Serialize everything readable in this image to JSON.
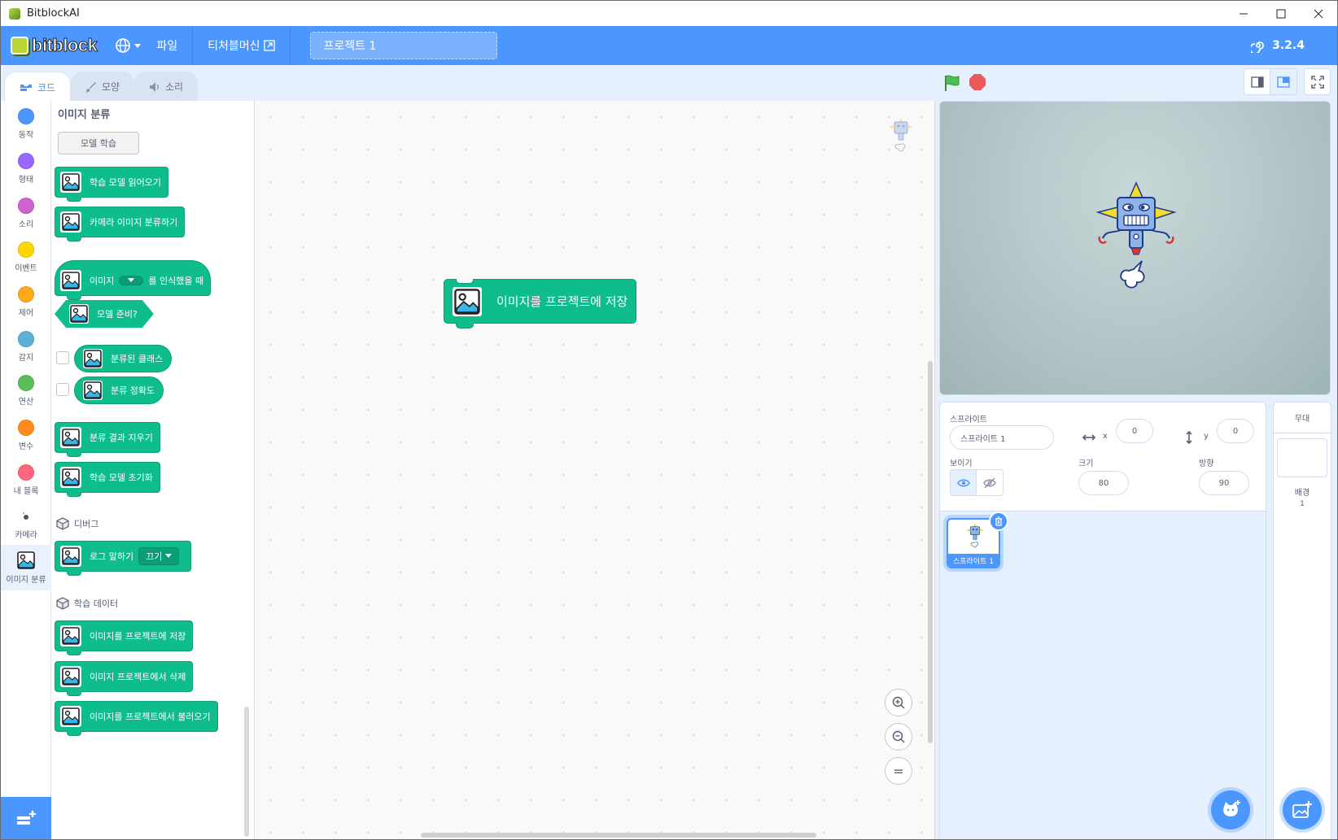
{
  "window": {
    "title": "BitblockAI",
    "controls": [
      "—",
      "☐",
      "✕"
    ]
  },
  "menubar": {
    "logo_text": "bitblock",
    "file_label": "파일",
    "teacher_label": "티처블머신",
    "project_title": "프로젝트 1",
    "version": "3.2.4"
  },
  "tabs": [
    {
      "label": "코드",
      "active": true
    },
    {
      "label": "모양",
      "active": false
    },
    {
      "label": "소리",
      "active": false
    }
  ],
  "categories": [
    {
      "label": "동작",
      "color": "#4c97ff"
    },
    {
      "label": "형태",
      "color": "#9966ff"
    },
    {
      "label": "소리",
      "color": "#cf63cf"
    },
    {
      "label": "이벤트",
      "color": "#ffd500"
    },
    {
      "label": "제어",
      "color": "#ffab19"
    },
    {
      "label": "감지",
      "color": "#5cb1d6"
    },
    {
      "label": "연산",
      "color": "#59c059"
    },
    {
      "label": "변수",
      "color": "#ff8c1a"
    },
    {
      "label": "내 블록",
      "color": "#ff6680"
    },
    {
      "label": "카메라",
      "color": "#555555"
    },
    {
      "label": "이미지 분류",
      "color": "#0fbd8c"
    }
  ],
  "palette": {
    "title": "이미지 분류",
    "train_button": "모델 학습",
    "blocks": {
      "load_model": "학습 모델 읽어오기",
      "classify_camera": "카메라 이미지 분류하기",
      "when_recognized_pre": "이미지",
      "when_recognized_post": "를 인식했을 때",
      "model_ready": "모델 준비?",
      "classified_class": "분류된 클래스",
      "class_accuracy": "분류 정확도",
      "clear_result": "분류 결과 지우기",
      "reset_model": "학습 모델 초기화",
      "log_say": "로그 말하기",
      "log_option": "끄기",
      "save_images": "이미지를 프로젝트에 저장",
      "delete_images": "이미지 프로젝트에서 삭제",
      "load_images": "이미지를 프로젝트에서 불러오기"
    },
    "section_debug": "디버그",
    "section_data": "학습 데이터"
  },
  "workspace": {
    "block_label": "이미지를 프로젝트에 저장",
    "zoom_reset": "="
  },
  "sprite_info": {
    "sprite_label": "스프라이트",
    "sprite_name": "스프라이트 1",
    "x_label": "x",
    "x_value": "0",
    "y_label": "y",
    "y_value": "0",
    "show_label": "보이기",
    "size_label": "크기",
    "size_value": "80",
    "direction_label": "방향",
    "direction_value": "90",
    "thumb_name": "스프라이트 1"
  },
  "stage_pane": {
    "header": "무대",
    "backdrop_label": "배경",
    "backdrop_count": "1"
  },
  "colors": {
    "accent": "#4c97ff",
    "extension": "#0fbd8c"
  }
}
